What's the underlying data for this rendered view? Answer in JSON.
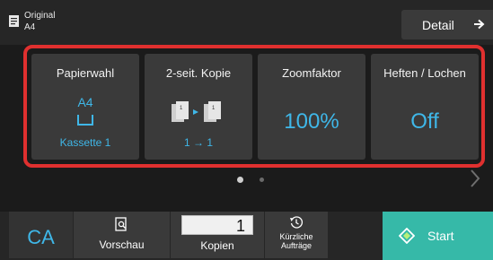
{
  "header": {
    "original_label": "Original",
    "original_size": "A4",
    "detail_label": "Detail"
  },
  "tiles": {
    "paper": {
      "title": "Papierwahl",
      "size": "A4",
      "tray": "Kassette 1"
    },
    "duplex": {
      "title": "2-seit. Kopie",
      "mode": "1 → 1"
    },
    "zoom": {
      "title": "Zoomfaktor",
      "value": "100%"
    },
    "finish": {
      "title": "Heften / Lochen",
      "value": "Off"
    }
  },
  "bottom": {
    "ca_label": "CA",
    "preview_label": "Vorschau",
    "copies_value": "1",
    "copies_label": "Kopien",
    "recent_label_line1": "Kürzliche",
    "recent_label_line2": "Aufträge",
    "start_label": "Start"
  },
  "colors": {
    "accent": "#3fb7e8",
    "highlight_frame": "#e0302f",
    "start": "#36b9a8"
  }
}
